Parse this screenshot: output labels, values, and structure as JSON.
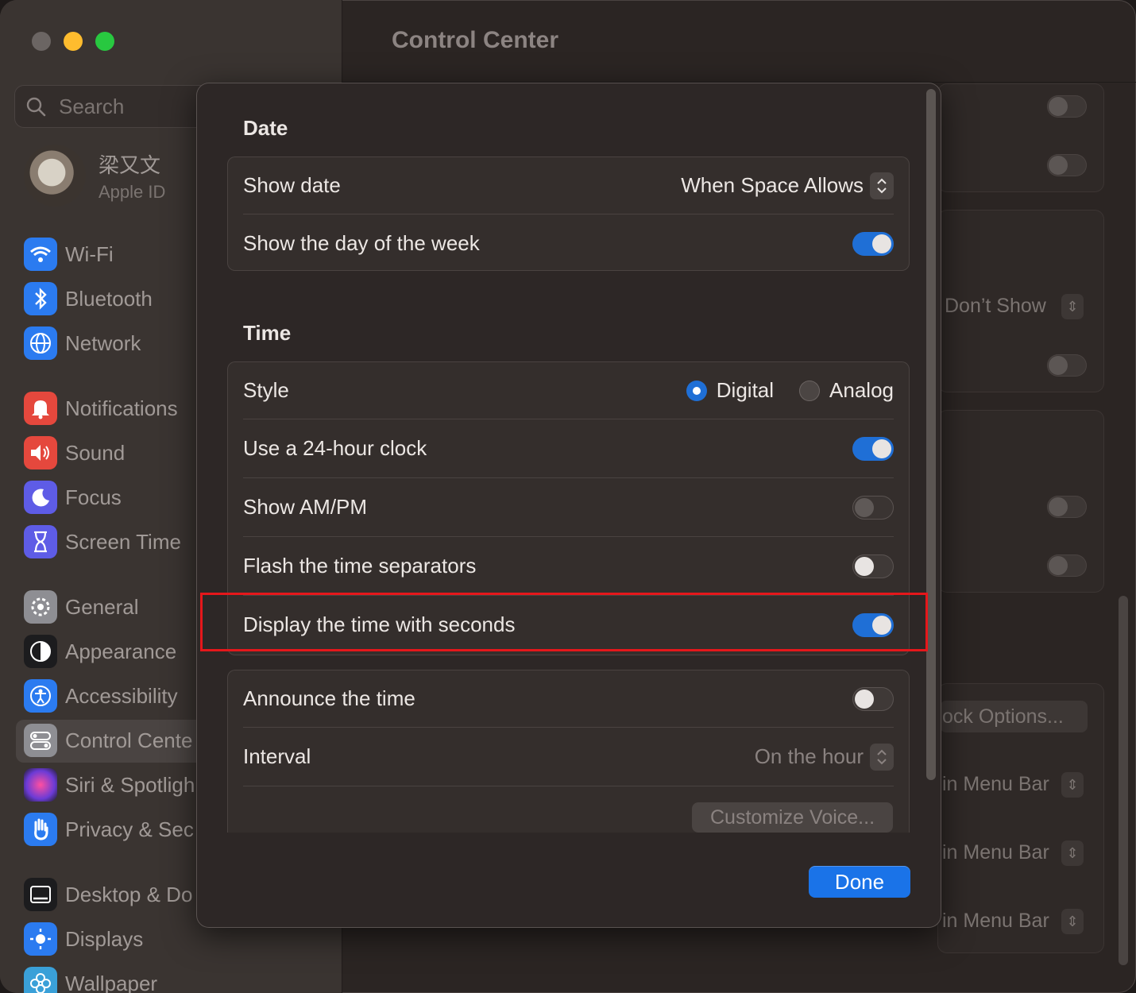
{
  "window": {
    "title": "Control Center"
  },
  "sidebar": {
    "search_placeholder": "Search",
    "apple_id": {
      "name": "梁又文",
      "subtitle": "Apple ID"
    },
    "items": [
      {
        "label": "Wi-Fi",
        "icon": "wifi-icon",
        "color": "#2b7bf0"
      },
      {
        "label": "Bluetooth",
        "icon": "bluetooth-icon",
        "color": "#2b7bf0"
      },
      {
        "label": "Network",
        "icon": "globe-icon",
        "color": "#2b7bf0"
      },
      {
        "label": "Notifications",
        "icon": "bell-icon",
        "color": "#e5483d"
      },
      {
        "label": "Sound",
        "icon": "speaker-icon",
        "color": "#e5483d"
      },
      {
        "label": "Focus",
        "icon": "moon-icon",
        "color": "#5e5ce6"
      },
      {
        "label": "Screen Time",
        "icon": "hourglass-icon",
        "color": "#5e5ce6"
      },
      {
        "label": "General",
        "icon": "gear-icon",
        "color": "#8e8e93"
      },
      {
        "label": "Appearance",
        "icon": "appearance-icon",
        "color": "#1c1c1e"
      },
      {
        "label": "Accessibility",
        "icon": "accessibility-icon",
        "color": "#2b7bf0"
      },
      {
        "label": "Control Cente",
        "icon": "control-center-icon",
        "color": "#8e8e93"
      },
      {
        "label": "Siri & Spotligh",
        "icon": "siri-icon",
        "color": "#b845d6"
      },
      {
        "label": "Privacy & Sec",
        "icon": "hand-icon",
        "color": "#2b7bf0"
      },
      {
        "label": "Desktop & Do",
        "icon": "dock-icon",
        "color": "#1c1c1e"
      },
      {
        "label": "Displays",
        "icon": "sun-icon",
        "color": "#2b7bf0"
      },
      {
        "label": "Wallpaper",
        "icon": "flower-icon",
        "color": "#3aa0d8"
      }
    ]
  },
  "background": {
    "dont_show": "Don’t Show",
    "clock_options": "ock Options...",
    "in_menu_bar": "in Menu Bar"
  },
  "sheet": {
    "date_title": "Date",
    "show_date_label": "Show date",
    "show_date_value": "When Space Allows",
    "show_day_label": "Show the day of the week",
    "show_day_on": true,
    "time_title": "Time",
    "style_label": "Style",
    "style_digital": "Digital",
    "style_analog": "Analog",
    "style_selected": "Digital",
    "clock24_label": "Use a 24-hour clock",
    "clock24_on": true,
    "ampm_label": "Show AM/PM",
    "ampm_on": false,
    "flash_label": "Flash the time separators",
    "flash_on": false,
    "seconds_label": "Display the time with seconds",
    "seconds_on": true,
    "announce_label": "Announce the time",
    "announce_on": false,
    "interval_label": "Interval",
    "interval_value": "On the hour",
    "customize_voice": "Customize Voice...",
    "done": "Done"
  },
  "colors": {
    "accent": "#1a73e8",
    "highlight": "#e5171b"
  }
}
